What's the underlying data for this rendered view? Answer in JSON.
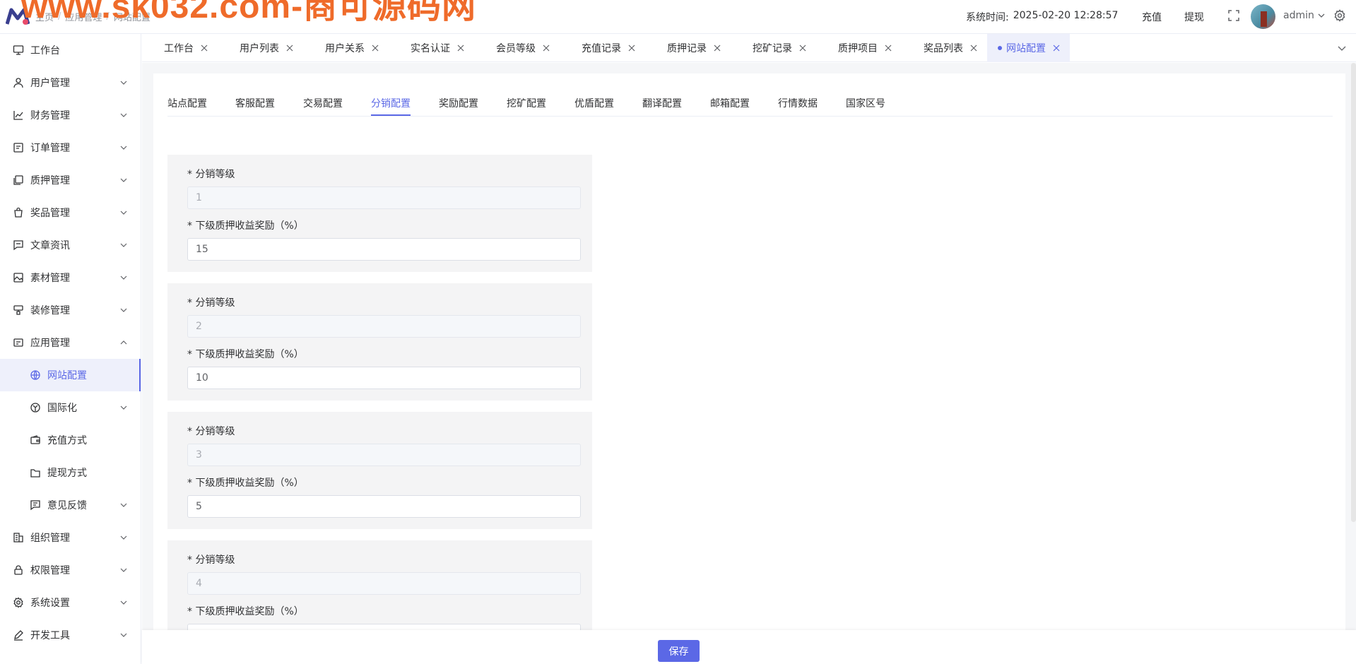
{
  "header": {
    "breadcrumb": [
      "主页",
      "应用管理",
      "网站配置"
    ],
    "watermark": "www.sk032.com-商可源码网",
    "sys_time_label": "系统时间:",
    "sys_time_value": "2025-02-20 12:28:57",
    "recharge": "充值",
    "withdraw": "提现",
    "user": "admin"
  },
  "sidebar": {
    "items": [
      {
        "label": "工作台",
        "icon": "monitor-icon"
      },
      {
        "label": "用户管理",
        "icon": "user-icon"
      },
      {
        "label": "财务管理",
        "icon": "chart-icon"
      },
      {
        "label": "订单管理",
        "icon": "order-icon"
      },
      {
        "label": "质押管理",
        "icon": "stack-icon"
      },
      {
        "label": "奖品管理",
        "icon": "bag-icon"
      },
      {
        "label": "文章资讯",
        "icon": "message-icon"
      },
      {
        "label": "素材管理",
        "icon": "image-icon"
      },
      {
        "label": "装修管理",
        "icon": "brush-icon"
      },
      {
        "label": "应用管理",
        "icon": "app-icon"
      },
      {
        "label": "网站配置",
        "icon": "globe-icon"
      },
      {
        "label": "国际化",
        "icon": "i18n-icon"
      },
      {
        "label": "充值方式",
        "icon": "wallet-icon"
      },
      {
        "label": "提现方式",
        "icon": "folder-icon"
      },
      {
        "label": "意见反馈",
        "icon": "feedback-icon"
      },
      {
        "label": "组织管理",
        "icon": "building-icon"
      },
      {
        "label": "权限管理",
        "icon": "lock-icon"
      },
      {
        "label": "系统设置",
        "icon": "gear-icon"
      },
      {
        "label": "开发工具",
        "icon": "pen-icon"
      }
    ]
  },
  "tabs": [
    "工作台",
    "用户列表",
    "用户关系",
    "实名认证",
    "会员等级",
    "充值记录",
    "质押记录",
    "挖矿记录",
    "质押项目",
    "奖品列表",
    "网站配置"
  ],
  "subtabs": [
    "站点配置",
    "客服配置",
    "交易配置",
    "分销配置",
    "奖励配置",
    "挖矿配置",
    "优盾配置",
    "翻译配置",
    "邮箱配置",
    "行情数据",
    "国家区号"
  ],
  "form": {
    "level_label": "* 分销等级",
    "reward_label": "* 下级质押收益奖励（%）",
    "levels": [
      {
        "level": "1",
        "reward": "15"
      },
      {
        "level": "2",
        "reward": "10"
      },
      {
        "level": "3",
        "reward": "5"
      },
      {
        "level": "4",
        "reward": ""
      }
    ]
  },
  "footer": {
    "save": "保存"
  },
  "colors": {
    "accent": "#5b68e6",
    "watermark": "#ef6b2a"
  }
}
